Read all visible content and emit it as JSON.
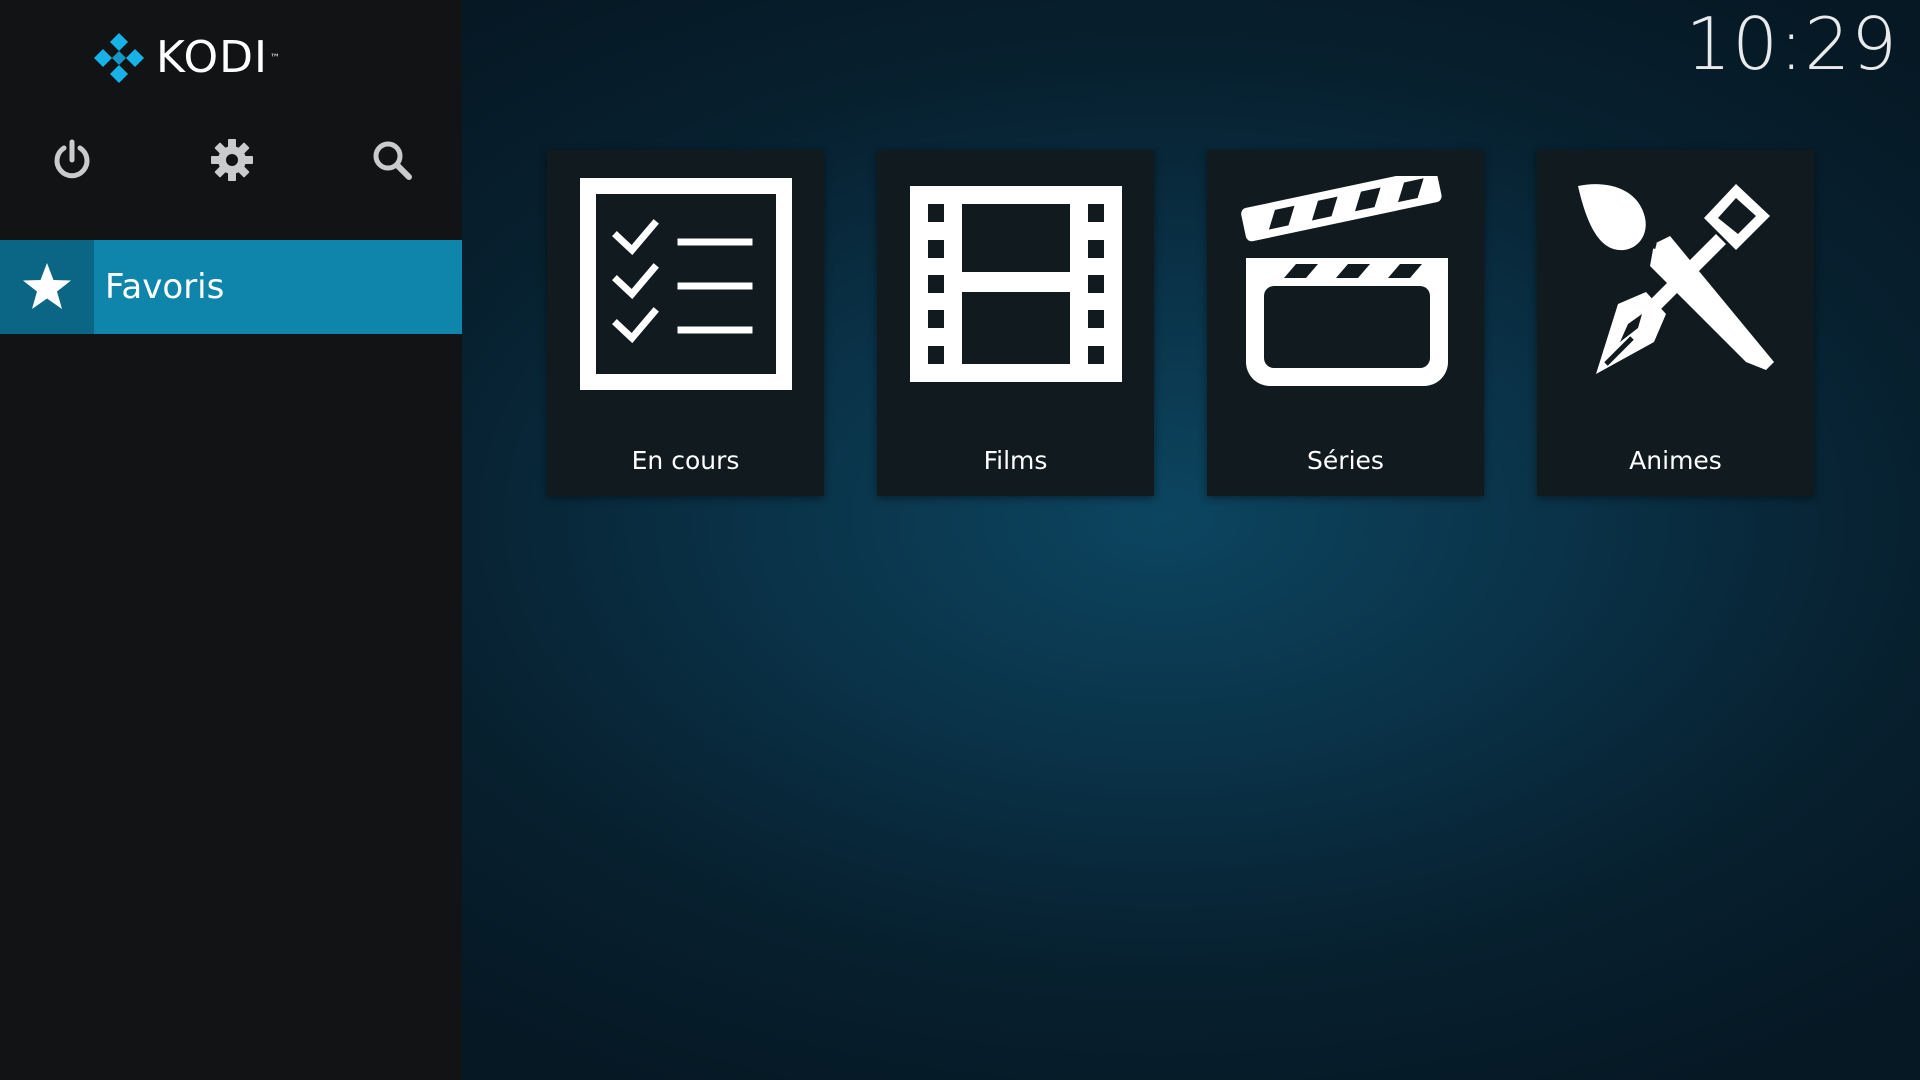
{
  "app": {
    "name": "KODI",
    "trademark": "™"
  },
  "header": {
    "clock": "10:29"
  },
  "sidebar": {
    "buttons": [
      {
        "icon": "power-icon"
      },
      {
        "icon": "gear-icon"
      },
      {
        "icon": "search-icon"
      }
    ],
    "items": [
      {
        "label": "Favoris",
        "icon": "star-icon",
        "selected": true
      }
    ]
  },
  "main": {
    "tiles": [
      {
        "label": "En cours",
        "icon": "checklist-icon"
      },
      {
        "label": "Films",
        "icon": "film-strip-icon"
      },
      {
        "label": "Séries",
        "icon": "clapperboard-icon"
      },
      {
        "label": "Animes",
        "icon": "brush-pen-icon"
      }
    ]
  },
  "colors": {
    "accent": "#0f85ab",
    "accent_dark": "#0b6686",
    "sidebar_bg": "#111315",
    "main_bg": "#0a3349",
    "tile_bg": "#111a1f",
    "logo_blue": "#17b2e7"
  }
}
